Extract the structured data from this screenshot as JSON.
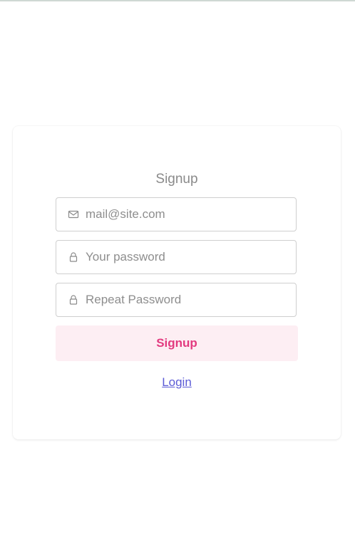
{
  "form": {
    "title": "Signup",
    "email": {
      "placeholder": "mail@site.com",
      "icon": "mail-icon"
    },
    "password": {
      "placeholder": "Your password",
      "icon": "lock-icon"
    },
    "repeat_password": {
      "placeholder": "Repeat Password",
      "icon": "lock-icon"
    },
    "submit_label": "Signup",
    "login_link_label": "Login"
  },
  "colors": {
    "accent": "#e23a7f",
    "button_bg": "#fdeef3",
    "link": "#5b5bd6"
  }
}
